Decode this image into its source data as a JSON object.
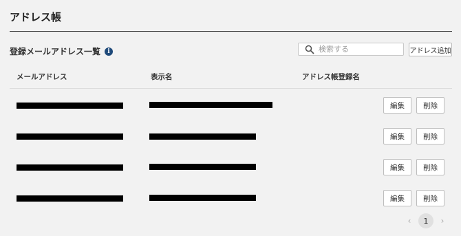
{
  "page": {
    "title": "アドレス帳"
  },
  "section": {
    "title": "登録メールアドレス一覧",
    "info_icon": "i"
  },
  "search": {
    "placeholder": "検索する"
  },
  "toolbar": {
    "add_label": "アドレス追加"
  },
  "table": {
    "columns": [
      "メールアドレス",
      "表示名",
      "アドレス帳登録名"
    ],
    "rows": [
      {
        "edit_label": "編集",
        "delete_label": "削除"
      },
      {
        "edit_label": "編集",
        "delete_label": "削除"
      },
      {
        "edit_label": "編集",
        "delete_label": "削除"
      },
      {
        "edit_label": "編集",
        "delete_label": "削除"
      }
    ]
  },
  "pagination": {
    "prev": "‹",
    "current": "1",
    "next": "›"
  }
}
